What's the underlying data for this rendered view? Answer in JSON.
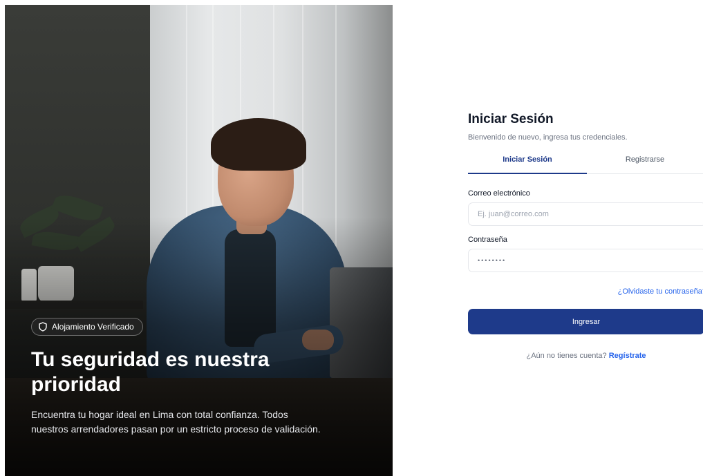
{
  "hero": {
    "badge": "Alojamiento Verificado",
    "badge_icon": "shield-icon",
    "title": "Tu seguridad es nuestra prioridad",
    "description": "Encuentra tu hogar ideal en Lima con total confianza. Todos nuestros arrendadores pasan por un estricto proceso de validación."
  },
  "login": {
    "title": "Iniciar Sesión",
    "subtitle": "Bienvenido de nuevo, ingresa tus credenciales.",
    "tabs": [
      {
        "label": "Iniciar Sesión",
        "active": true
      },
      {
        "label": "Registrarse",
        "active": false
      }
    ],
    "email_label": "Correo electrónico",
    "email_placeholder": "Ej. juan@correo.com",
    "password_label": "Contraseña",
    "password_value": "••••••••",
    "forgot_link": "¿Olvidaste tu contraseña?",
    "submit_label": "Ingresar",
    "signup_prompt": "¿Aún no tienes cuenta?",
    "signup_link": "Regístrate"
  },
  "colors": {
    "primary": "#1e3a8a",
    "link": "#2563eb"
  }
}
